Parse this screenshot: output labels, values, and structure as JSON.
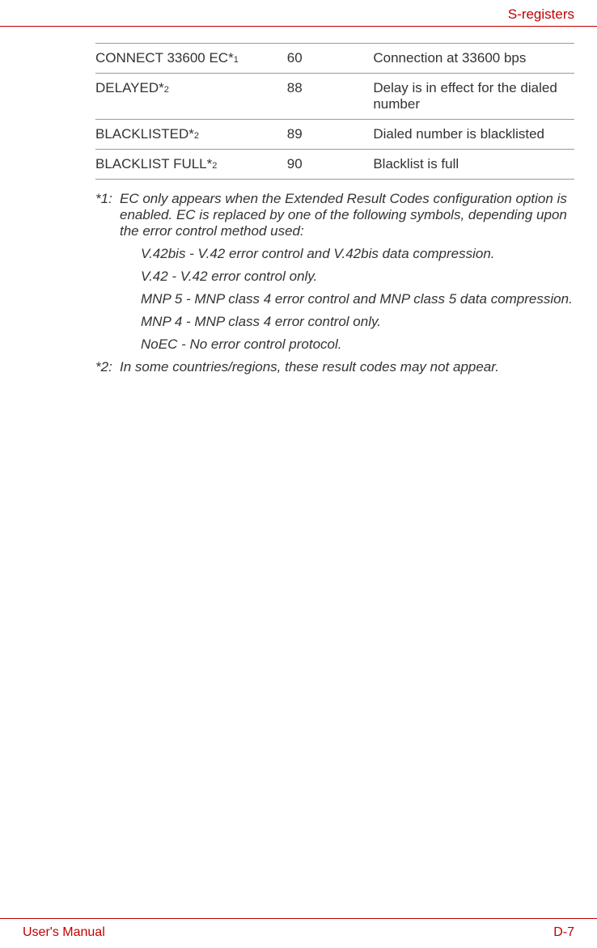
{
  "header": {
    "title": "S-registers"
  },
  "table": {
    "rows": [
      {
        "name": "CONNECT 33600 EC*",
        "noteref": "1",
        "code": "60",
        "desc": "Connection at 33600 bps"
      },
      {
        "name": "DELAYED*",
        "noteref": "2",
        "code": "88",
        "desc": "Delay is in effect for the dialed number"
      },
      {
        "name": "BLACKLISTED*",
        "noteref": "2",
        "code": "89",
        "desc": "Dialed number is blacklisted"
      },
      {
        "name": "BLACKLIST FULL*",
        "noteref": "2",
        "code": "90",
        "desc": "Blacklist is full"
      }
    ]
  },
  "notes": {
    "n1": {
      "label": "*1:",
      "text": "EC only appears when the Extended Result Codes configuration option is enabled. EC is replaced by one of the following symbols, depending upon the error control method used:",
      "subs": [
        "V.42bis - V.42 error control and V.42bis data compression.",
        "V.42 - V.42 error control only.",
        "MNP 5 - MNP class 4 error control and MNP class 5 data compression.",
        "MNP 4 - MNP class 4 error control only.",
        "NoEC - No error control protocol."
      ]
    },
    "n2": {
      "label": "*2:",
      "text": "In some countries/regions, these result codes may not appear."
    }
  },
  "footer": {
    "left": "User's Manual",
    "right": "D-7"
  }
}
